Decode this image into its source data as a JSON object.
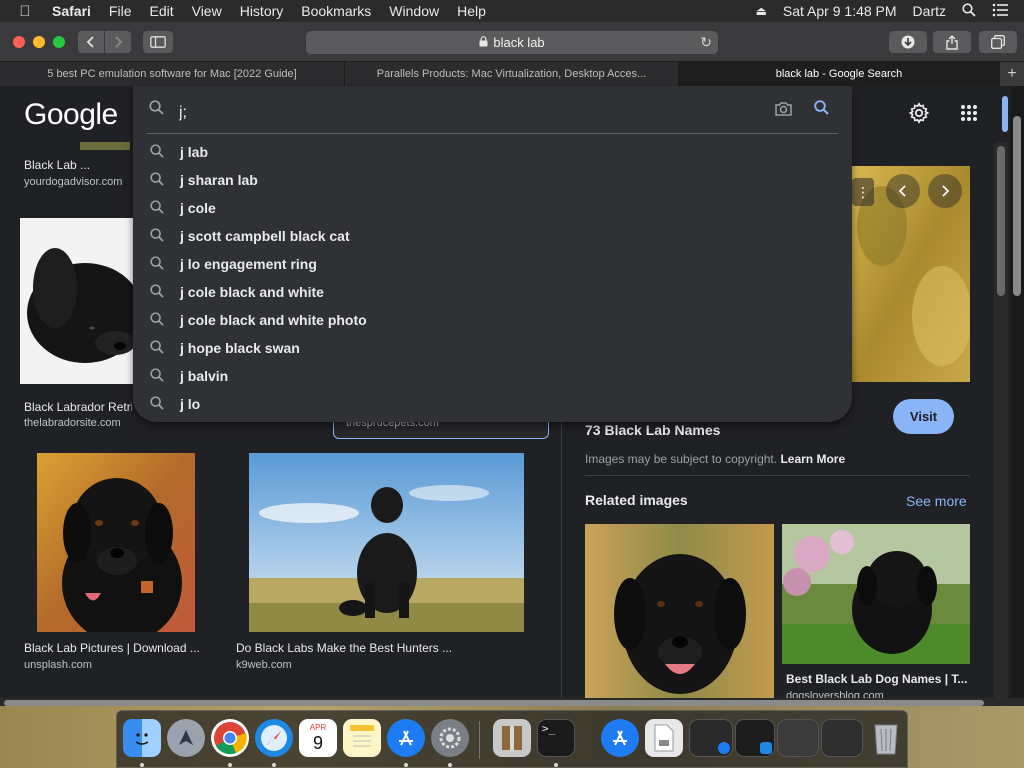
{
  "menubar": {
    "app": "Safari",
    "items": [
      "File",
      "Edit",
      "View",
      "History",
      "Bookmarks",
      "Window",
      "Help"
    ],
    "datetime": "Sat Apr 9  1:48 PM",
    "user": "Dartz"
  },
  "toolbar": {
    "url": "black lab"
  },
  "tabs": [
    {
      "title": "5 best PC emulation software for Mac [2022 Guide]"
    },
    {
      "title": "Parallels Products: Mac Virtualization, Desktop Acces..."
    },
    {
      "title": "black lab - Google Search"
    }
  ],
  "page": {
    "logo": "Google",
    "search_value": "j;",
    "suggestions": [
      "j lab",
      "j sharan lab",
      "j cole",
      "j scott campbell black cat",
      "j lo engagement ring",
      "j cole black and white",
      "j cole black and white photo",
      "j hope black swan",
      "j balvin",
      "j lo"
    ],
    "results": [
      {
        "title": "Black Lab ...",
        "site": "yourdogadvisor.com"
      },
      {
        "title": "Black Labrador Retri...",
        "site": "thelabradorsite.com"
      },
      {
        "title": "",
        "site": "thesprucepets.com"
      },
      {
        "title": "Black Lab Pictures | Download ...",
        "site": "unsplash.com"
      },
      {
        "title": "Do Black Labs Make the Best Hunters ...",
        "site": "k9web.com"
      }
    ],
    "panel": {
      "visit_label": "Visit",
      "title": "73 Black Lab Names",
      "copyright_text": "Images may be subject to copyright.",
      "learn_more": "Learn More",
      "related_label": "Related images",
      "see_more": "See more",
      "related": [
        {
          "title": "",
          "site": ""
        },
        {
          "title": "Best Black Lab Dog Names | T...",
          "site": "dogsloversblog.com"
        }
      ]
    }
  },
  "dock": {
    "calendar_month": "APR",
    "calendar_day": "9"
  }
}
